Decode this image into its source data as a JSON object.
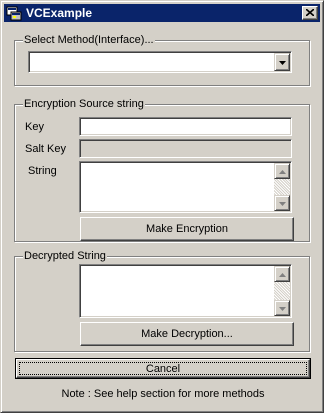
{
  "window": {
    "title": "VCExample",
    "icon": "app-icon",
    "close_icon": "close-icon"
  },
  "method_group": {
    "label": "Select Method(Interface)...",
    "select_value": "",
    "dropdown_icon": "chevron-down-icon"
  },
  "encryption_group": {
    "label": "Encryption Source string",
    "key_label": "Key",
    "key_value": "",
    "salt_key_label": "Salt Key",
    "salt_key_value": "",
    "string_label": "String",
    "string_value": "",
    "make_button": "Make Encryption"
  },
  "decryption_group": {
    "label": "Decrypted String",
    "value": "",
    "make_button": "Make Decryption..."
  },
  "cancel_button": "Cancel",
  "note": "Note : See help section for more methods",
  "colors": {
    "titlebar": "#0a246a",
    "face": "#d4d0c8",
    "shadow": "#808080"
  }
}
